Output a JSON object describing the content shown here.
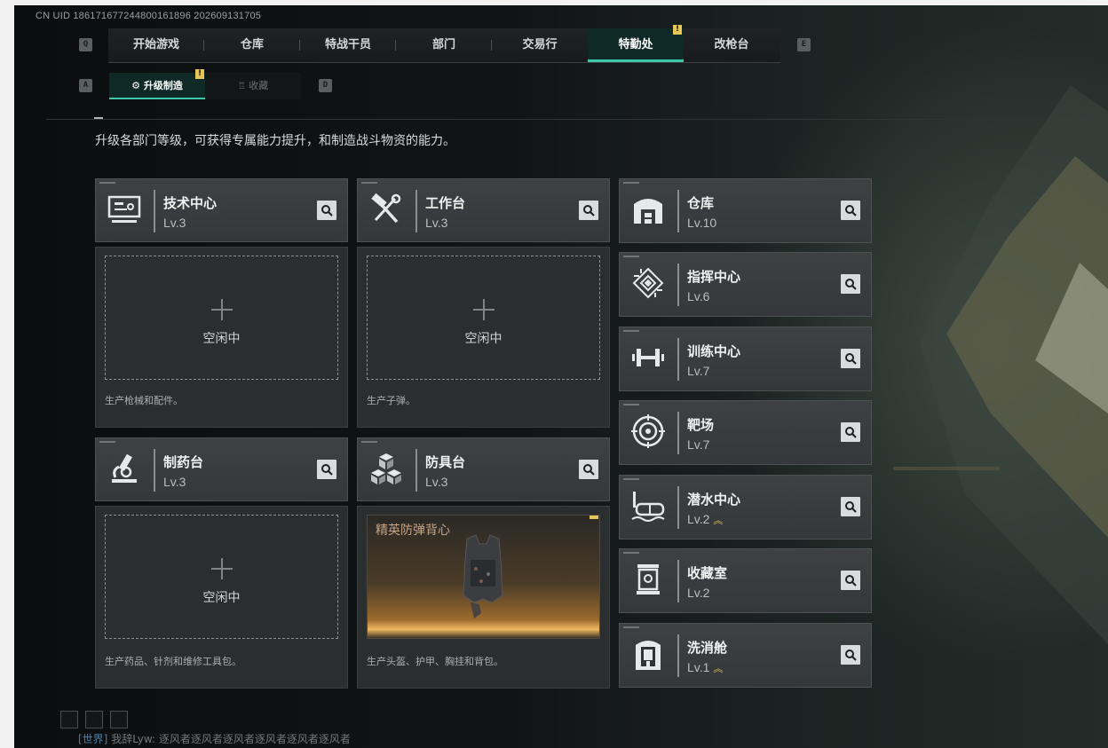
{
  "uid_text": "CN UID 186171677244800161896 202609131705",
  "nav": {
    "key_left": "Q",
    "key_right": "E",
    "tabs": [
      {
        "label": "开始游戏"
      },
      {
        "label": "仓库"
      },
      {
        "label": "特战干员"
      },
      {
        "label": "部门"
      },
      {
        "label": "交易行"
      },
      {
        "label": "特勤处",
        "active": true
      },
      {
        "label": "改枪台"
      }
    ]
  },
  "subnav": {
    "key_left": "A",
    "key_right": "D",
    "tabs": [
      {
        "label": "升级制造",
        "active": true
      },
      {
        "label": "收藏"
      }
    ]
  },
  "badge_text": "!",
  "description": "升级各部门等级，可获得专属能力提升，和制造战斗物资的能力。",
  "production": [
    {
      "name": "技术中心",
      "level": "Lv.3",
      "icon": "computer-terminal-icon",
      "slot_status": "空闲中",
      "note": "生产枪械和配件。"
    },
    {
      "name": "工作台",
      "level": "Lv.3",
      "icon": "hammer-wrench-icon",
      "slot_status": "空闲中",
      "note": "生产子弹。"
    },
    {
      "name": "制药台",
      "level": "Lv.3",
      "icon": "microscope-icon",
      "slot_status": "空闲中",
      "note": "生产药品、针剂和维修工具包。"
    },
    {
      "name": "防具台",
      "level": "Lv.3",
      "icon": "cubes-icon",
      "slot_item": "精英防弹背心",
      "note": "生产头盔、护甲、胸挂和背包。"
    }
  ],
  "facilities": [
    {
      "name": "仓库",
      "level": "Lv.10",
      "icon": "warehouse-icon",
      "upgradable": false
    },
    {
      "name": "指挥中心",
      "level": "Lv.6",
      "icon": "command-chip-icon",
      "upgradable": false
    },
    {
      "name": "训练中心",
      "level": "Lv.7",
      "icon": "dumbbell-icon",
      "upgradable": false
    },
    {
      "name": "靶场",
      "level": "Lv.7",
      "icon": "target-icon",
      "upgradable": false
    },
    {
      "name": "潜水中心",
      "level": "Lv.2",
      "icon": "diving-mask-icon",
      "upgradable": true
    },
    {
      "name": "收藏室",
      "level": "Lv.2",
      "icon": "display-case-icon",
      "upgradable": false
    },
    {
      "name": "洗消舱",
      "level": "Lv.1",
      "icon": "decon-pod-icon",
      "upgradable": true
    }
  ],
  "chat": {
    "channel": "[世界]",
    "text": "我辞Lyw: 逐风者逐风者逐风者逐风者逐风者逐风者"
  },
  "colors": {
    "accent": "#3ec7a8",
    "warn_badge": "#e8c558",
    "upgrade_arrow": "#e8c558"
  }
}
